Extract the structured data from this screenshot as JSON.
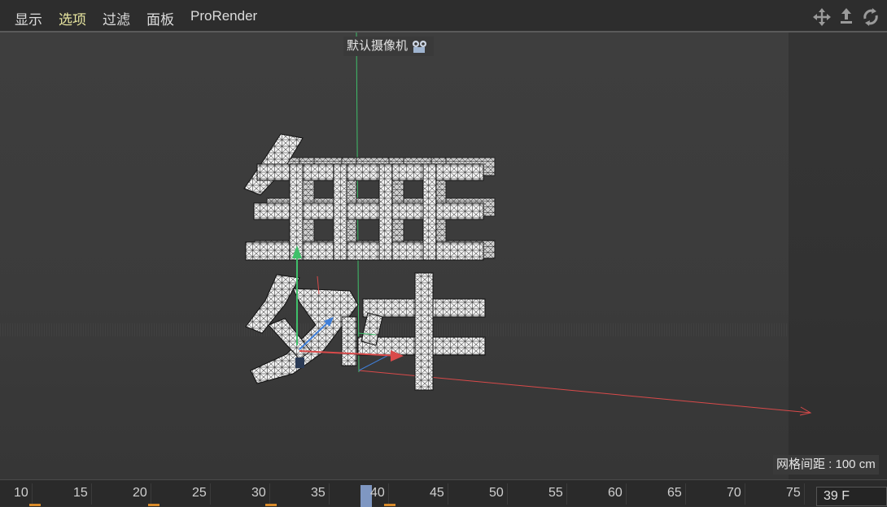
{
  "menu": {
    "items": [
      {
        "label": "显示",
        "active": false
      },
      {
        "label": "选项",
        "active": true
      },
      {
        "label": "过滤",
        "active": false
      },
      {
        "label": "面板",
        "active": false
      },
      {
        "label": "ProRender",
        "active": false
      }
    ],
    "nav_icons": [
      "move-view-icon",
      "zoom-view-icon",
      "rotate-view-icon"
    ]
  },
  "viewport": {
    "camera_label": "默认摄像机",
    "grid_spacing": "网格间距 : 100 cm",
    "model_glyph": "舞"
  },
  "timeline": {
    "ticks": [
      "10",
      "15",
      "20",
      "25",
      "30",
      "35",
      "40",
      "45",
      "50",
      "55",
      "60",
      "65",
      "70",
      "75"
    ],
    "current_frame": "39 F"
  },
  "colors": {
    "active_menu": "#e8e6a0",
    "playhead": "#7f97c2",
    "keyframe": "#d98b2a",
    "axis_x": "#d94a4a",
    "axis_y": "#3fbf6a",
    "axis_z": "#3f7fd9"
  }
}
